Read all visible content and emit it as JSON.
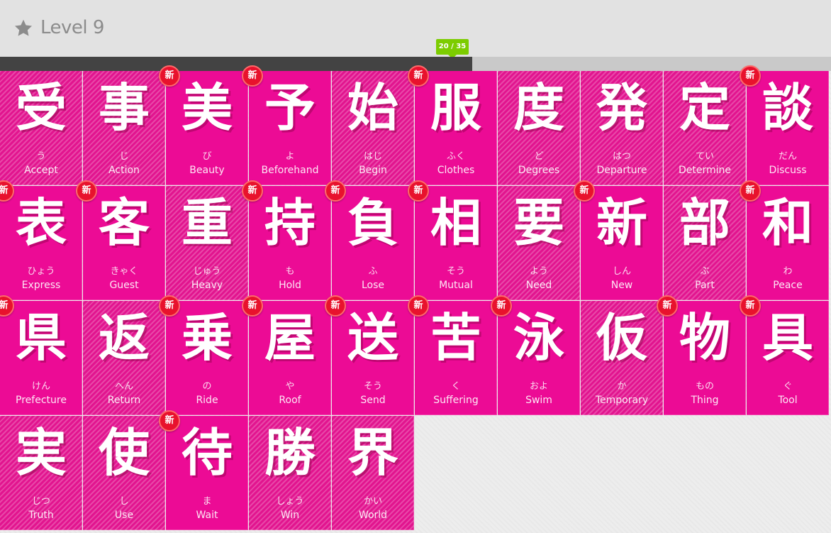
{
  "header": {
    "star_icon": "star-icon",
    "level_title": "Level 9"
  },
  "progress": {
    "label": "20 / 35",
    "fraction": 0.568
  },
  "badge_label": "新",
  "colors": {
    "tile_pink": "#ec0b95",
    "badge_red": "#e8122d",
    "progress_green": "#7ccc00",
    "progress_dark": "#434343"
  },
  "tiles": [
    {
      "kanji": "受",
      "reading": "う",
      "meaning": "Accept",
      "is_new": false,
      "striped": true
    },
    {
      "kanji": "事",
      "reading": "じ",
      "meaning": "Action",
      "is_new": false,
      "striped": true
    },
    {
      "kanji": "美",
      "reading": "び",
      "meaning": "Beauty",
      "is_new": true,
      "striped": false
    },
    {
      "kanji": "予",
      "reading": "よ",
      "meaning": "Beforehand",
      "is_new": true,
      "striped": false
    },
    {
      "kanji": "始",
      "reading": "はじ",
      "meaning": "Begin",
      "is_new": false,
      "striped": true
    },
    {
      "kanji": "服",
      "reading": "ふく",
      "meaning": "Clothes",
      "is_new": true,
      "striped": false
    },
    {
      "kanji": "度",
      "reading": "ど",
      "meaning": "Degrees",
      "is_new": false,
      "striped": true
    },
    {
      "kanji": "発",
      "reading": "はつ",
      "meaning": "Departure",
      "is_new": false,
      "striped": true
    },
    {
      "kanji": "定",
      "reading": "てい",
      "meaning": "Determine",
      "is_new": false,
      "striped": true
    },
    {
      "kanji": "談",
      "reading": "だん",
      "meaning": "Discuss",
      "is_new": true,
      "striped": false
    },
    {
      "kanji": "表",
      "reading": "ひょう",
      "meaning": "Express",
      "is_new": true,
      "striped": false
    },
    {
      "kanji": "客",
      "reading": "きゃく",
      "meaning": "Guest",
      "is_new": true,
      "striped": false
    },
    {
      "kanji": "重",
      "reading": "じゅう",
      "meaning": "Heavy",
      "is_new": false,
      "striped": true
    },
    {
      "kanji": "持",
      "reading": "も",
      "meaning": "Hold",
      "is_new": true,
      "striped": false
    },
    {
      "kanji": "負",
      "reading": "ふ",
      "meaning": "Lose",
      "is_new": true,
      "striped": false
    },
    {
      "kanji": "相",
      "reading": "そう",
      "meaning": "Mutual",
      "is_new": true,
      "striped": false
    },
    {
      "kanji": "要",
      "reading": "よう",
      "meaning": "Need",
      "is_new": false,
      "striped": true
    },
    {
      "kanji": "新",
      "reading": "しん",
      "meaning": "New",
      "is_new": true,
      "striped": false
    },
    {
      "kanji": "部",
      "reading": "ぶ",
      "meaning": "Part",
      "is_new": false,
      "striped": true
    },
    {
      "kanji": "和",
      "reading": "わ",
      "meaning": "Peace",
      "is_new": true,
      "striped": false
    },
    {
      "kanji": "県",
      "reading": "けん",
      "meaning": "Prefecture",
      "is_new": true,
      "striped": false
    },
    {
      "kanji": "返",
      "reading": "へん",
      "meaning": "Return",
      "is_new": false,
      "striped": true
    },
    {
      "kanji": "乗",
      "reading": "の",
      "meaning": "Ride",
      "is_new": true,
      "striped": false
    },
    {
      "kanji": "屋",
      "reading": "や",
      "meaning": "Roof",
      "is_new": true,
      "striped": false
    },
    {
      "kanji": "送",
      "reading": "そう",
      "meaning": "Send",
      "is_new": true,
      "striped": false
    },
    {
      "kanji": "苦",
      "reading": "く",
      "meaning": "Suffering",
      "is_new": true,
      "striped": false
    },
    {
      "kanji": "泳",
      "reading": "およ",
      "meaning": "Swim",
      "is_new": true,
      "striped": false
    },
    {
      "kanji": "仮",
      "reading": "か",
      "meaning": "Temporary",
      "is_new": false,
      "striped": true
    },
    {
      "kanji": "物",
      "reading": "もの",
      "meaning": "Thing",
      "is_new": true,
      "striped": false
    },
    {
      "kanji": "具",
      "reading": "ぐ",
      "meaning": "Tool",
      "is_new": true,
      "striped": false
    },
    {
      "kanji": "実",
      "reading": "じつ",
      "meaning": "Truth",
      "is_new": false,
      "striped": true
    },
    {
      "kanji": "使",
      "reading": "し",
      "meaning": "Use",
      "is_new": false,
      "striped": true
    },
    {
      "kanji": "待",
      "reading": "ま",
      "meaning": "Wait",
      "is_new": true,
      "striped": false
    },
    {
      "kanji": "勝",
      "reading": "しょう",
      "meaning": "Win",
      "is_new": false,
      "striped": true
    },
    {
      "kanji": "界",
      "reading": "かい",
      "meaning": "World",
      "is_new": false,
      "striped": true
    }
  ]
}
